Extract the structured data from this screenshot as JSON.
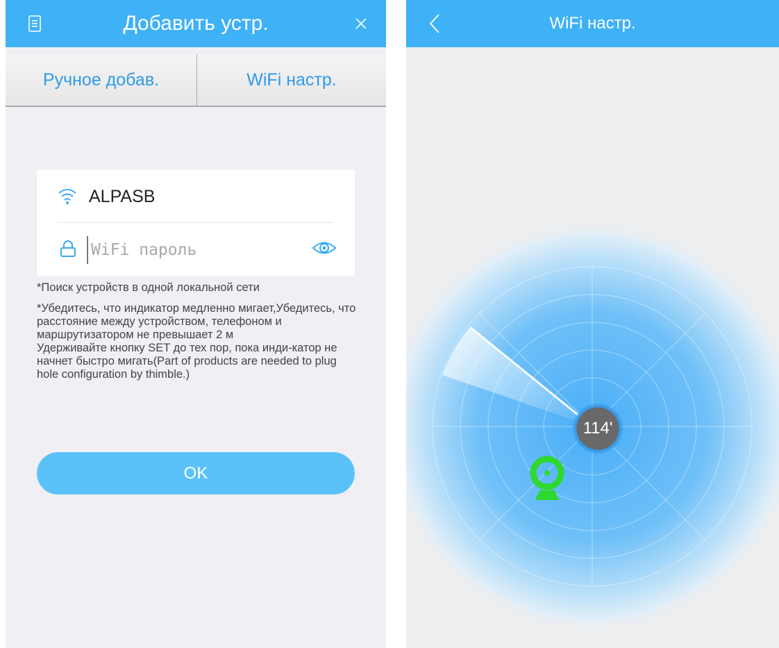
{
  "left_screen": {
    "appbar": {
      "title": "Добавить устр.",
      "menu_icon": "list-icon",
      "close_icon": "close-icon"
    },
    "tabs": [
      {
        "label": "Ручное добав."
      },
      {
        "label": "WiFi настр."
      }
    ],
    "wifi_form": {
      "ssid": "ALPASB",
      "password_placeholder": "WiFi пароль",
      "password_value": ""
    },
    "notes": {
      "note1": "*Поиск устройств в одной локальной сети",
      "note2": "*Убедитесь, что индикатор медленно мигает,Убедитесь, что расстояние между устройством, телефоном и маршрутизатором не превышает 2 м",
      "note3": "Удерживайте кнопку SET до тех пор, пока инди-катор не начнет быстро мигать(Part of products are needed to plug hole configuration by thimble.)"
    },
    "ok_button": {
      "label": "OK"
    }
  },
  "right_screen": {
    "appbar": {
      "title": "WiFi настр.",
      "back_icon": "chevron-left-icon"
    },
    "radar": {
      "countdown": "114'",
      "device_icon": "camera-icon"
    }
  },
  "colors": {
    "appbar": "#3eb1f7",
    "accent_text": "#2f9be8",
    "ok_button": "#5ac2f9",
    "radar_core": "#4fb3f8",
    "device_icon": "#2fd82f"
  }
}
